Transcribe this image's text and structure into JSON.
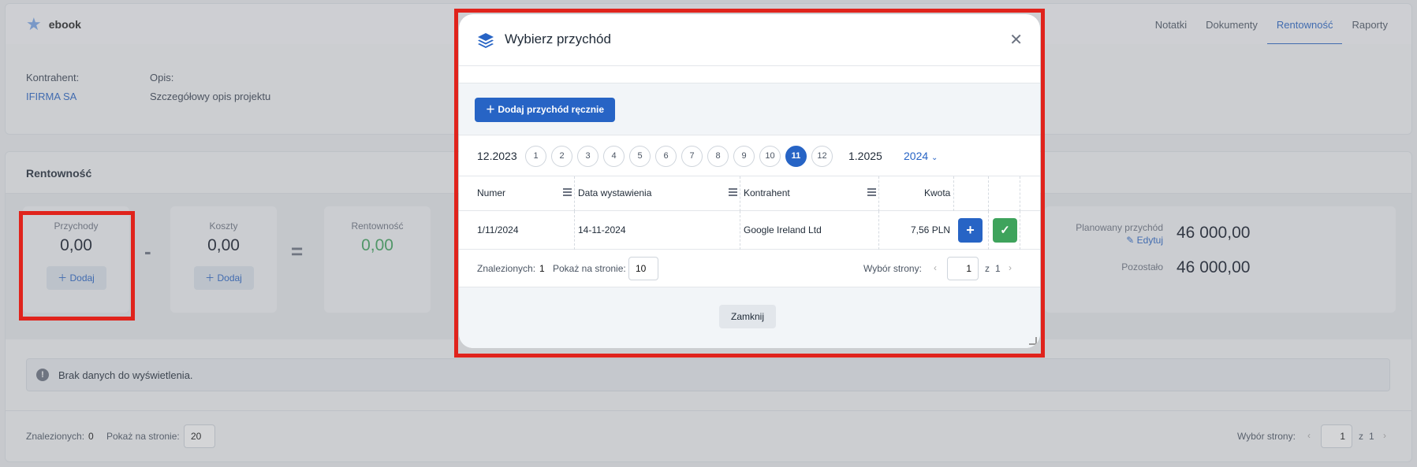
{
  "app": {
    "title": "ebook",
    "icon": "star-icon"
  },
  "tabs": [
    {
      "label": "Notatki"
    },
    {
      "label": "Dokumenty"
    },
    {
      "label": "Rentowność",
      "active": true
    },
    {
      "label": "Raporty"
    }
  ],
  "info": {
    "contractor_label": "Kontrahent:",
    "contractor_value": "IFIRMA SA",
    "description_label": "Opis:",
    "description_value": "Szczegółowy opis projektu"
  },
  "rentownosc": {
    "title": "Rentowność",
    "revenue": {
      "label": "Przychody",
      "value": "0,00",
      "add": "Dodaj"
    },
    "costs": {
      "label": "Koszty",
      "value": "0,00",
      "add": "Dodaj"
    },
    "profit": {
      "label": "Rentowność",
      "value": "0,00"
    },
    "minus": "-",
    "equals": "=",
    "planned_label": "Planowany przychód",
    "planned_edit": "Edytuj",
    "planned_value": "46 000,00",
    "remaining_label": "Pozostało",
    "remaining_value": "46 000,00",
    "empty_text": "Brak danych do wyświetlenia.",
    "footer": {
      "found_label": "Znalezionych:",
      "found_value": "0",
      "per_page_label": "Pokaż na stronie:",
      "per_page_value": "20",
      "page_label": "Wybór strony:",
      "page_value": "1",
      "of_label": "z",
      "total_pages": "1"
    }
  },
  "modal": {
    "title": "Wybierz przychód",
    "icon": "layers-icon",
    "add_manual": "Dodaj przychód ręcznie",
    "prev_month": "12.2023",
    "next_month": "1.2025",
    "months": [
      "1",
      "2",
      "3",
      "4",
      "5",
      "6",
      "7",
      "8",
      "9",
      "10",
      "11",
      "12"
    ],
    "active_month": "11",
    "year": "2024",
    "columns": [
      "Numer",
      "Data wystawienia",
      "Kontrahent",
      "Kwota"
    ],
    "rows": [
      {
        "number": "1/11/2024",
        "date": "14-11-2024",
        "contractor": "Google Ireland Ltd",
        "amount": "7,56 PLN"
      }
    ],
    "footer": {
      "found_label": "Znalezionych:",
      "found_value": "1",
      "per_page_label": "Pokaż na stronie:",
      "per_page_value": "10",
      "page_label": "Wybór strony:",
      "page_value": "1",
      "of_label": "z",
      "total_pages": "1"
    },
    "close_label": "Zamknij"
  },
  "colors": {
    "accent": "#2764c5",
    "success": "#3ea35c",
    "highlight": "#e0231c"
  }
}
